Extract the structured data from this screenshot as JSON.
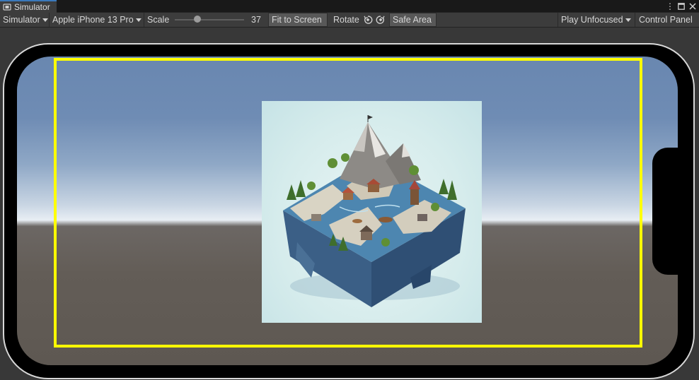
{
  "window": {
    "tab_title": "Simulator",
    "tab_icon": "simulator-window-icon",
    "controls": [
      "more-options-icon",
      "maximize-icon",
      "close-icon"
    ]
  },
  "toolbar": {
    "mode_dropdown": "Simulator",
    "device_dropdown": "Apple iPhone 13 Pro",
    "scale_label": "Scale",
    "scale_value": "37",
    "fit_to_screen": "Fit to Screen",
    "rotate_label": "Rotate",
    "rotate_icons": [
      "rotate-left-icon",
      "rotate-right-icon"
    ],
    "safe_area": "Safe Area",
    "play_mode_dropdown": "Play Unfocused",
    "control_panel": "Control Panel"
  },
  "viewport": {
    "device_orientation": "landscape",
    "safe_area_color": "#ffff00",
    "content": "isometric-island-artwork"
  },
  "colors": {
    "tab_accent": "#3a79bb",
    "sky": "#6987b0",
    "ground": "#635d57",
    "water": "#4d86b0"
  }
}
